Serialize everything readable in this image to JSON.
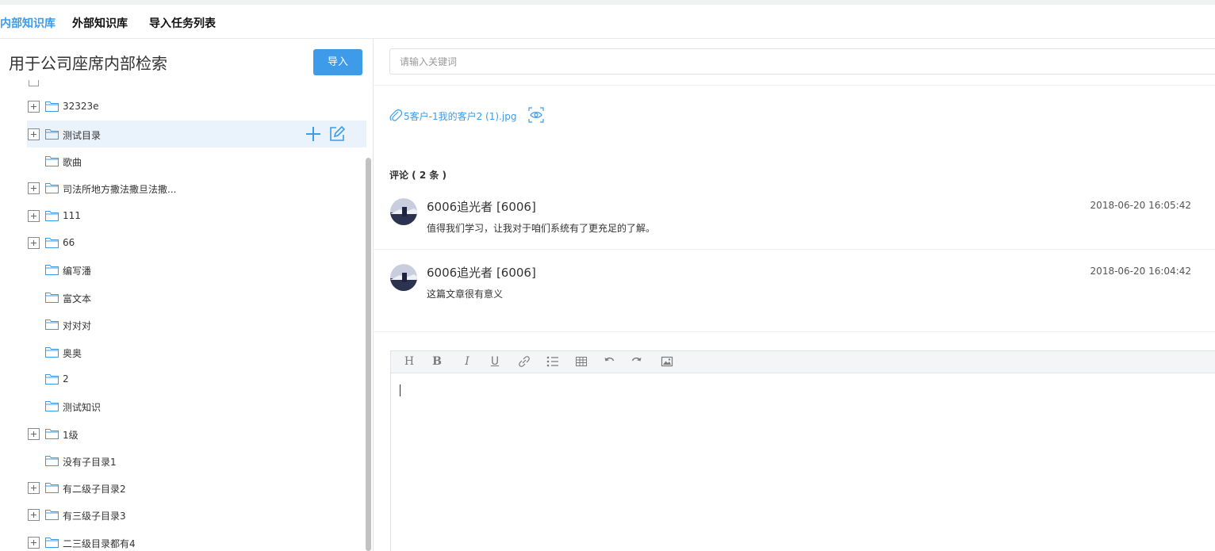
{
  "tabs": [
    {
      "label": "内部知识库",
      "active": true
    },
    {
      "label": "外部知识库",
      "active": false
    },
    {
      "label": "导入任务列表",
      "active": false
    }
  ],
  "left": {
    "title": "用于公司座席内部检索",
    "import_label": "导入",
    "tree": [
      {
        "label": "32323e",
        "expandable": true
      },
      {
        "label": "测试目录",
        "expandable": true,
        "selected": true
      },
      {
        "label": "歌曲",
        "expandable": false
      },
      {
        "label": "司法所地方撒法撒旦法撒...",
        "expandable": true
      },
      {
        "label": "111",
        "expandable": true
      },
      {
        "label": "66",
        "expandable": true
      },
      {
        "label": "编写潘",
        "expandable": false
      },
      {
        "label": "富文本",
        "expandable": false
      },
      {
        "label": "对对对",
        "expandable": false
      },
      {
        "label": "奥奥",
        "expandable": false
      },
      {
        "label": "2",
        "expandable": false
      },
      {
        "label": "测试知识",
        "expandable": false
      },
      {
        "label": "1级",
        "expandable": true
      },
      {
        "label": "没有子目录1",
        "expandable": false
      },
      {
        "label": "有二级子目录2",
        "expandable": true
      },
      {
        "label": "有三级子目录3",
        "expandable": true
      },
      {
        "label": "二三级目录都有4",
        "expandable": true
      }
    ]
  },
  "right": {
    "search_placeholder": "请输入关键词",
    "attachment": "5客户-1我的客户2 (1).jpg",
    "comments_title": "评论 ( 2 条 )",
    "comments": [
      {
        "user": "6006追光者 [6006]",
        "text": "值得我们学习，让我对于咱们系统有了更充足的了解。",
        "time": "2018-06-20 16:05:42"
      },
      {
        "user": "6006追光者 [6006]",
        "text": "这篇文章很有意义",
        "time": "2018-06-20 16:04:42"
      }
    ],
    "editor_toolbar": [
      "H",
      "B",
      "I",
      "U",
      "link",
      "list",
      "table",
      "undo",
      "redo",
      "image"
    ]
  },
  "colors": {
    "accent": "#3d9be9",
    "selected_row": "#eaf3fc",
    "border": "#e3e5e8"
  }
}
